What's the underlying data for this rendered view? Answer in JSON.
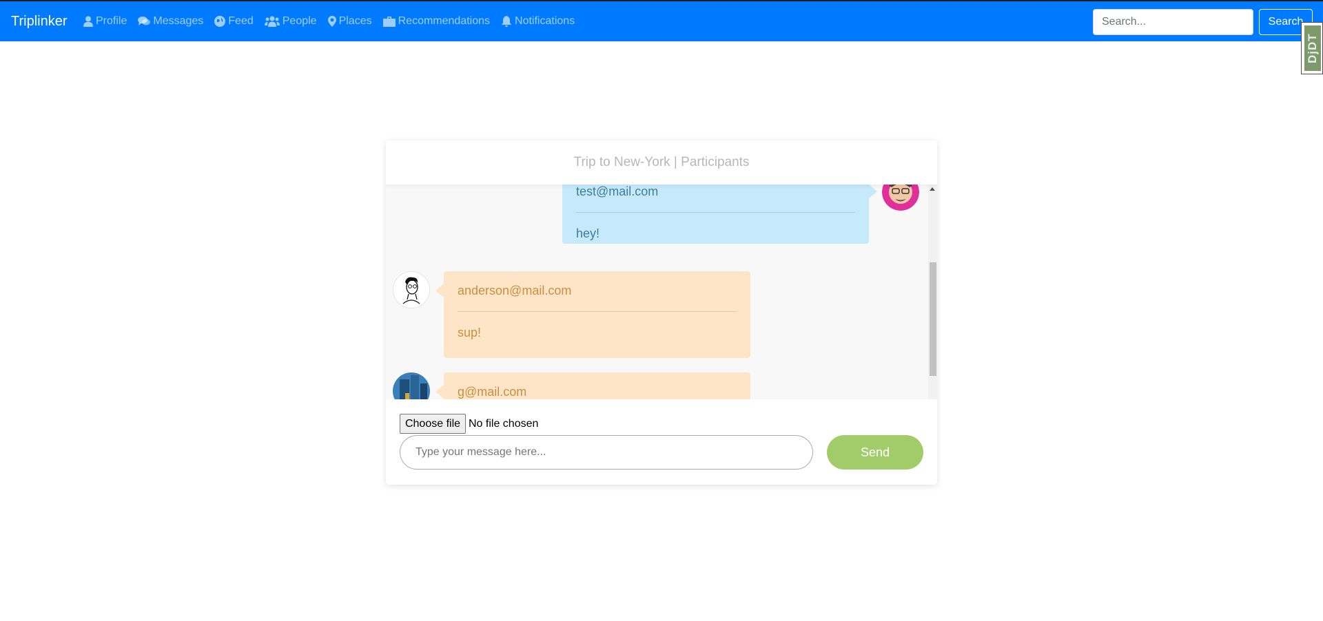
{
  "navbar": {
    "brand": "Triplinker",
    "items": [
      {
        "label": "Profile",
        "icon": "user-icon"
      },
      {
        "label": "Messages",
        "icon": "comments-icon"
      },
      {
        "label": "Feed",
        "icon": "globe-icon"
      },
      {
        "label": "People",
        "icon": "users-icon"
      },
      {
        "label": "Places",
        "icon": "map-marker-icon"
      },
      {
        "label": "Recommendations",
        "icon": "briefcase-icon"
      },
      {
        "label": "Notifications",
        "icon": "bell-icon"
      }
    ],
    "search_placeholder": "Search...",
    "search_label": "Search"
  },
  "ddt_label": "DjDT",
  "chat": {
    "title": "Trip to New-York | Participants",
    "messages": [
      {
        "sender": "test@mail.com",
        "text": "hey!",
        "side": "right"
      },
      {
        "sender": "anderson@mail.com",
        "text": "sup!",
        "side": "left"
      },
      {
        "sender": "g@mail.com",
        "text": "",
        "side": "left"
      }
    ],
    "file_button": "Choose file",
    "file_status": "No file chosen",
    "message_placeholder": "Type your message here...",
    "send_label": "Send"
  },
  "colors": {
    "navbar": "#007bff",
    "mine_bubble": "#c6e9fb",
    "theirs_bubble": "#ffe5c8",
    "send_button": "#a2cc6a"
  }
}
